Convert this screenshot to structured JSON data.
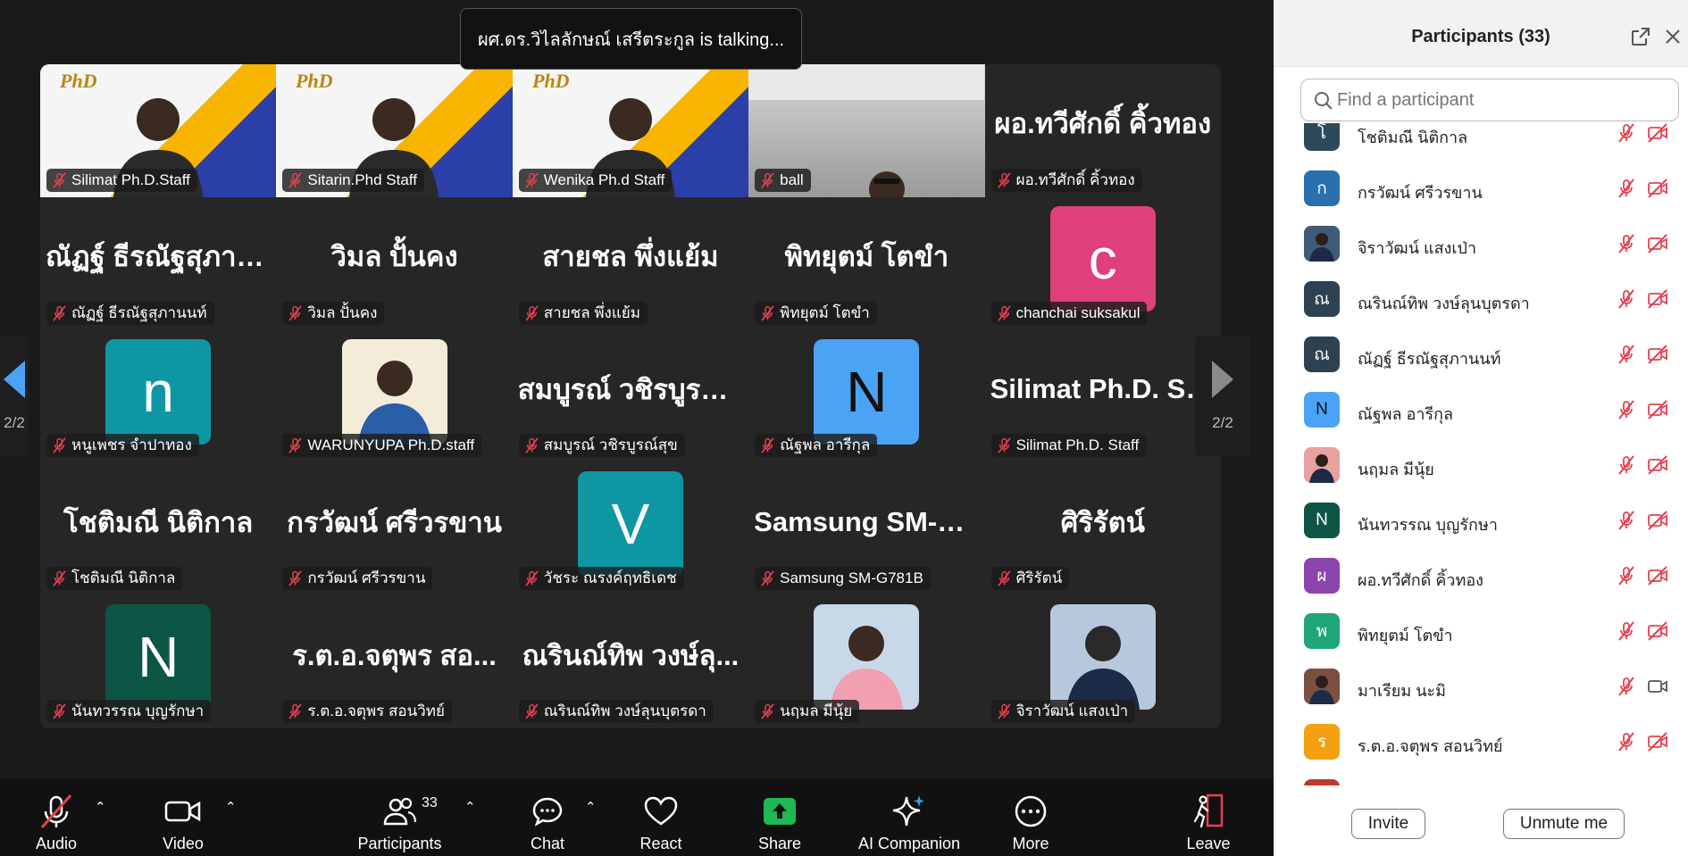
{
  "talking_banner": "ผศ.ดร.วิไลลักษณ์ เสรีตระกูล is talking...",
  "pager": {
    "left": "2/2",
    "right": "2/2"
  },
  "tiles": [
    {
      "label": "Silimat Ph.D.Staff",
      "kind": "video"
    },
    {
      "label": "Sitarin.Phd Staff",
      "kind": "video"
    },
    {
      "label": "Wenika Ph.d Staff",
      "kind": "video"
    },
    {
      "label": "ball",
      "kind": "video"
    },
    {
      "big": "ผอ.ทวีศักดิ์  คิ้วทอง",
      "label": "ผอ.ทวีศักดิ์  คิ้วทอง",
      "kind": "name"
    },
    {
      "big": "ณัฏฐ์ ธีรณัฐสุภาน...",
      "label": "ณัฏฐ์ ธีรณัฐสุภานนท์",
      "kind": "name"
    },
    {
      "big": "วิมล ปั้นคง",
      "label": "วิมล ปั้นคง",
      "kind": "name"
    },
    {
      "big": "สายชล พึ่งแย้ม",
      "label": "สายชล พึ่งแย้ม",
      "kind": "name"
    },
    {
      "big": "พิทยุตม์  โตขำ",
      "label": "พิทยุตม์  โตขำ",
      "kind": "name"
    },
    {
      "letter": "c",
      "color": "#e0407a",
      "label": "chanchai suksakul",
      "kind": "avatar"
    },
    {
      "letter": "n",
      "color": "#0e97a3",
      "label": "หนูเพชร จำปาทอง",
      "kind": "avatar"
    },
    {
      "label": "WARUNYUPA Ph.D.staff",
      "kind": "photo"
    },
    {
      "big": "สมบูรณ์ วชิรบูรณ์...",
      "label": "สมบูรณ์ วชิรบูรณ์สุข",
      "kind": "name"
    },
    {
      "letter": "N",
      "color": "#4aa3f5",
      "label": "ณัฐพล อารีกุล",
      "kind": "avatar",
      "dark": true
    },
    {
      "big": "Silimat Ph.D. St...",
      "label": "Silimat Ph.D. Staff",
      "kind": "name"
    },
    {
      "big": "โชติมณี นิติกาล",
      "label": "โชติมณี นิติกาล",
      "kind": "name"
    },
    {
      "big": "กรวัฒน์ ศรีวรขาน",
      "label": "กรวัฒน์ ศรีวรขาน",
      "kind": "name"
    },
    {
      "letter": "V",
      "color": "#0e97a3",
      "label": "วัชระ ณรงค์ฤทธิเดช",
      "kind": "avatar"
    },
    {
      "big": "Samsung  SM-G...",
      "label": "Samsung SM-G781B",
      "kind": "name"
    },
    {
      "big": "ศิริรัตน์",
      "label": "ศิริรัตน์",
      "kind": "name"
    },
    {
      "letter": "N",
      "color": "#0d5645",
      "label": "นันทวรรณ บุญรักษา",
      "kind": "avatar"
    },
    {
      "big": "ร.ต.อ.จตุพร  สอ...",
      "label": "ร.ต.อ.จตุพร  สอนวิทย์",
      "kind": "name"
    },
    {
      "big": "ณรินณ์ทิพ วงษ์ลุ...",
      "label": "ณรินณ์ทิพ วงษ์ลุนบุตรดา",
      "kind": "name"
    },
    {
      "label": "นฤมล  มีนุ้ย",
      "kind": "photo"
    },
    {
      "label": "จิราวัฒน์ แสงเป่า",
      "kind": "photo"
    }
  ],
  "toolbar": {
    "audio": "Audio",
    "video": "Video",
    "participants": "Participants",
    "participants_count": "33",
    "chat": "Chat",
    "react": "React",
    "share": "Share",
    "ai": "AI Companion",
    "more": "More",
    "leave": "Leave"
  },
  "panel": {
    "title": "Participants (33)",
    "search_placeholder": "Find a participant",
    "invite": "Invite",
    "unmute_me": "Unmute me",
    "participants": [
      {
        "initial": "โ",
        "color": "#2d4a5c",
        "name": "โชติมณี นิติกาล",
        "cam": "off"
      },
      {
        "initial": "ก",
        "color": "#2a6fb0",
        "name": "กรวัฒน์ ศรีวรขาน",
        "cam": "off"
      },
      {
        "initial": "",
        "color": "#3f5b78",
        "name": "จิราวัฒน์ แสงเป่า",
        "cam": "off",
        "photo": true
      },
      {
        "initial": "ณ",
        "color": "#2d4150",
        "name": "ณรินณ์ทิพ วงษ์ลุนบุตรดา",
        "cam": "off"
      },
      {
        "initial": "ณ",
        "color": "#2d4150",
        "name": "ณัฏฐ์ ธีรณัฐสุภานนท์",
        "cam": "off"
      },
      {
        "initial": "N",
        "color": "#4aa3f5",
        "name": "ณัฐพล อารีกุล",
        "cam": "off",
        "dark": true
      },
      {
        "initial": "",
        "color": "#e8a0a0",
        "name": "นฤมล  มีนุ้ย",
        "cam": "off",
        "photo": true
      },
      {
        "initial": "N",
        "color": "#0d5645",
        "name": "นันทวรรณ บุญรักษา",
        "cam": "off"
      },
      {
        "initial": "ผ",
        "color": "#8e44ad",
        "name": "ผอ.ทวีศักดิ์  คิ้วทอง",
        "cam": "off"
      },
      {
        "initial": "พ",
        "color": "#1fa67a",
        "name": "พิทยุตม์  โตขำ",
        "cam": "off"
      },
      {
        "initial": "",
        "color": "#7a5040",
        "name": "มาเรียม นะมิ",
        "cam": "on",
        "photo": true
      },
      {
        "initial": "ร",
        "color": "#f5a011",
        "name": "ร.ต.อ.จตุพร  สอนวิทย์",
        "cam": "off"
      },
      {
        "initial": "",
        "color": "#c0392b",
        "name": "",
        "cam": "off"
      }
    ]
  },
  "colors": {
    "muted_red": "#e5404f",
    "share_green": "#1db954",
    "ai_blue": "#3aa0e8"
  }
}
